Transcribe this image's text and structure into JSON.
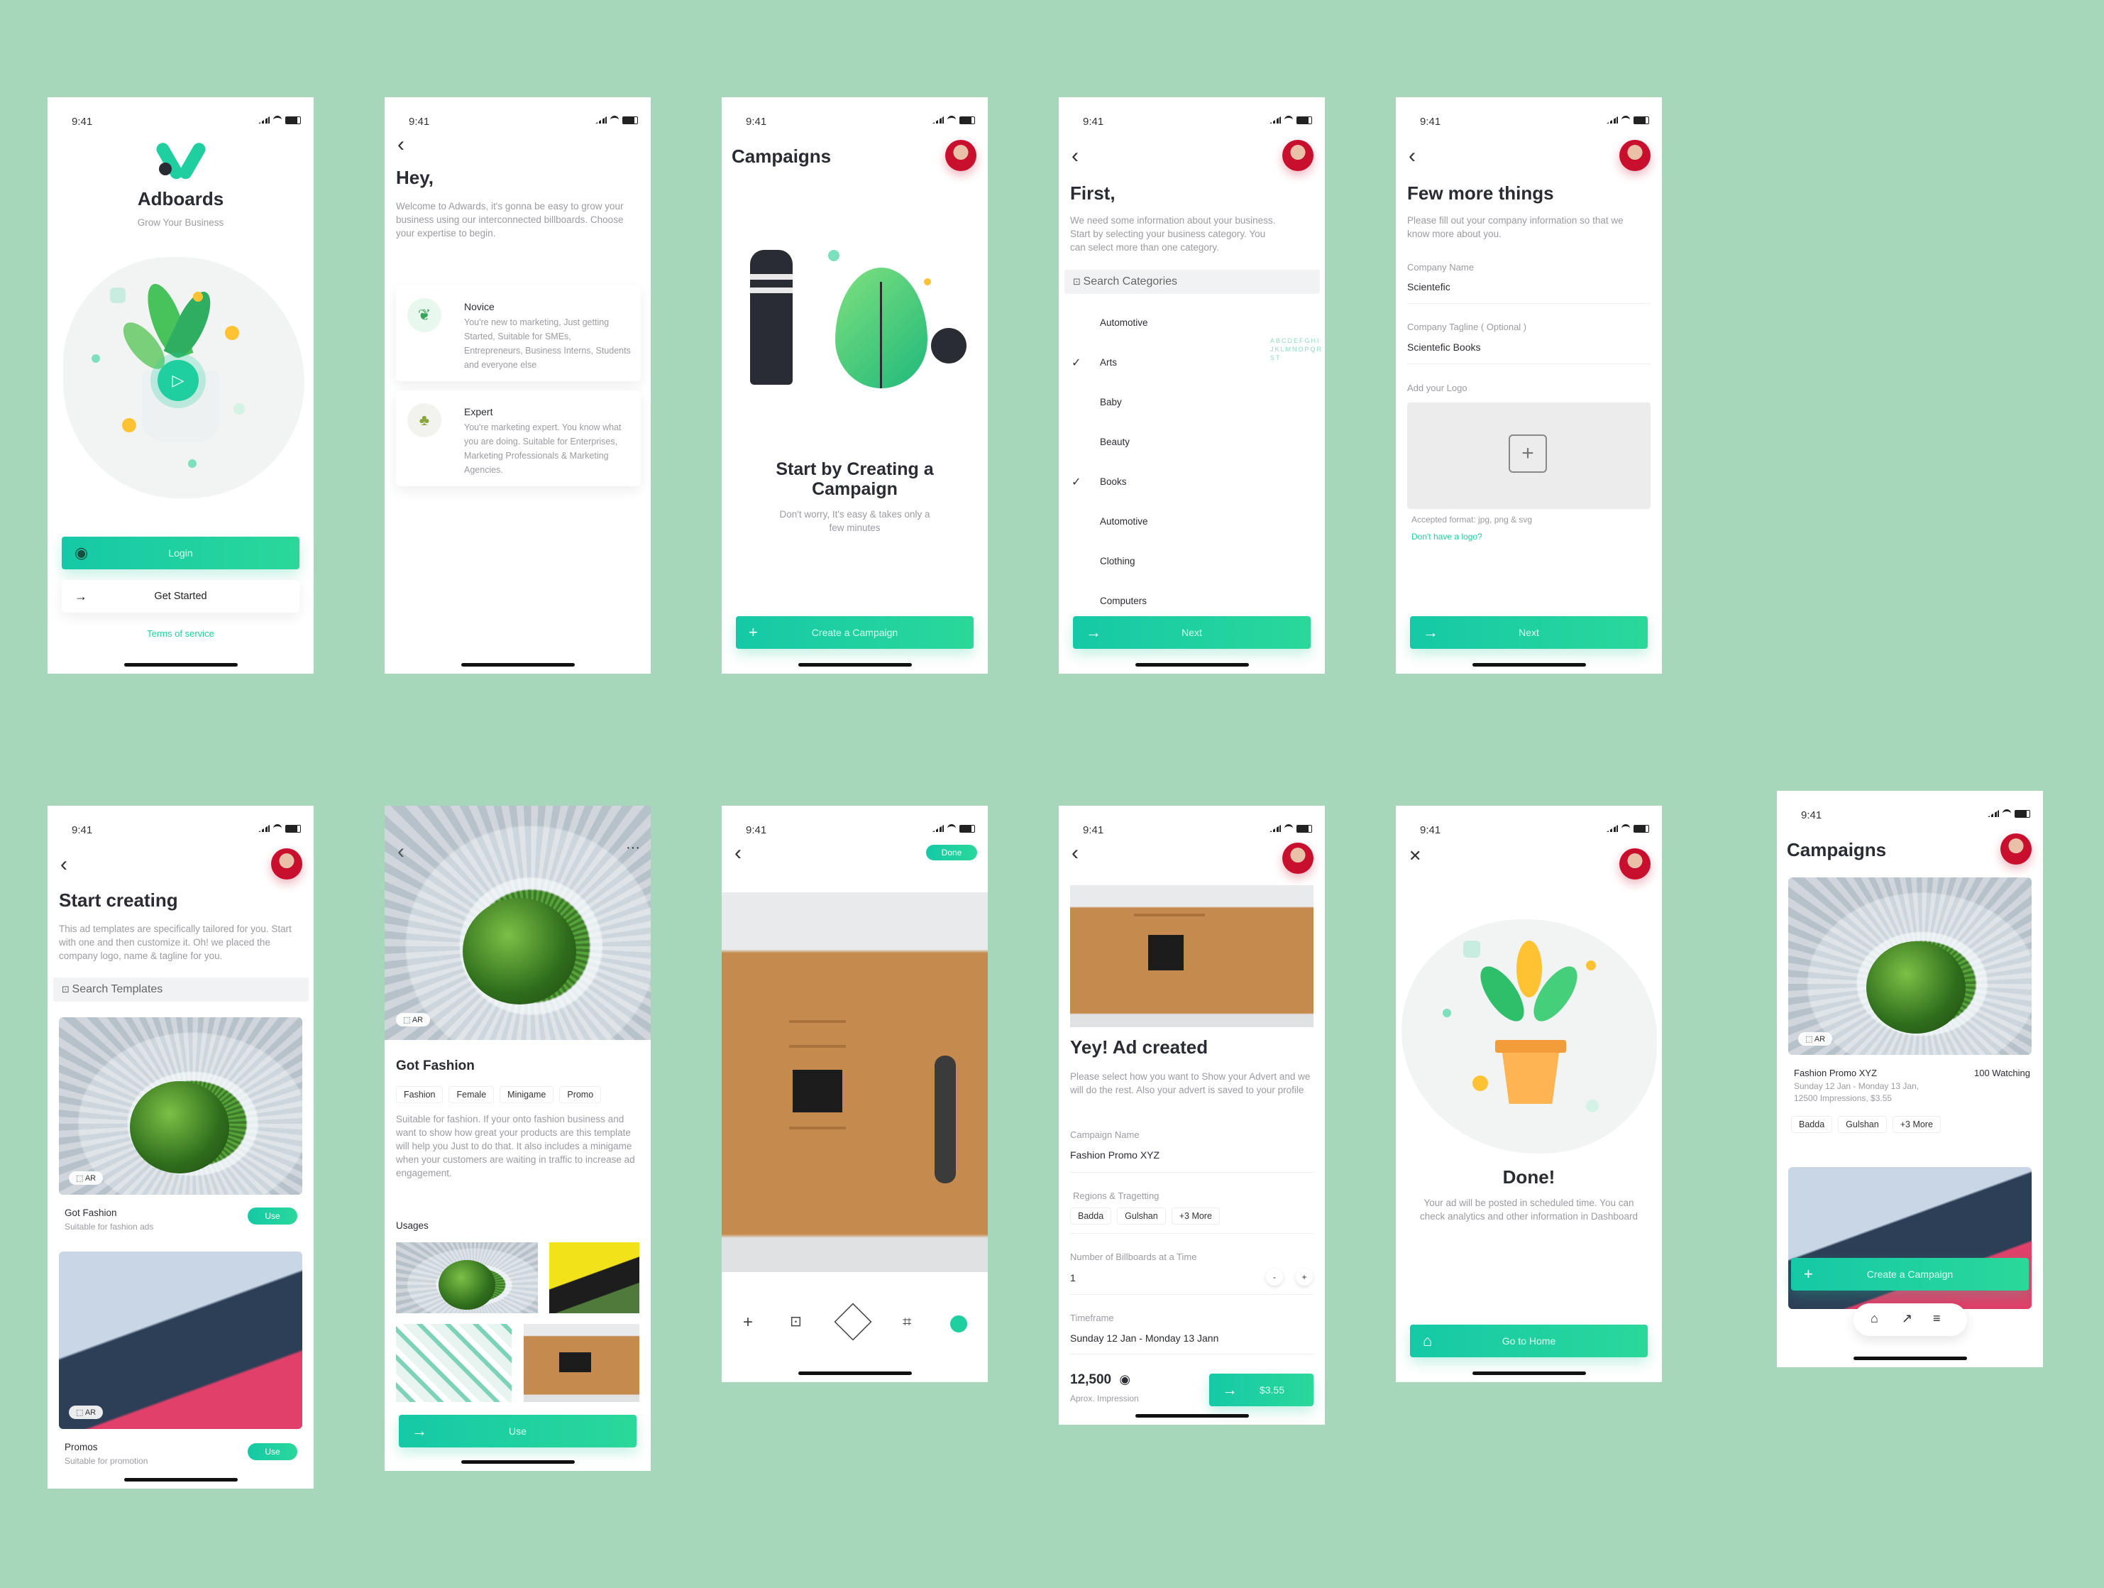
{
  "status_time": "9:41",
  "s1": {
    "brand": "Adboards",
    "tagline": "Grow Your Business",
    "login": "Login",
    "get_started": "Get Started",
    "terms": "Terms of service"
  },
  "s2": {
    "title": "Hey,",
    "intro": "Welcome to Adwards, it's gonna be easy to grow your business using our interconnected billboards. Choose your expertise to begin.",
    "options": [
      {
        "title": "Novice",
        "desc": "You're new to marketing, Just getting Started, Suitable for SMEs, Entrepreneurs, Business Interns, Students and everyone else"
      },
      {
        "title": "Expert",
        "desc": "You're marketing expert. You know what you are doing. Suitable for Enterprises, Marketing Professionals & Marketing Agencies."
      }
    ]
  },
  "s3": {
    "title": "Campaigns",
    "headline": "Start by Creating a Campaign",
    "sub": "Don't worry, It's easy & takes only a few minutes",
    "cta": "Create a Campaign"
  },
  "s4": {
    "title": "First,",
    "intro": "We need some information about your business. Start by selecting your business category. You can select more than one category.",
    "search": "Search Categories",
    "alphabet": "ABCDEFGHIJKLMNOPQRST",
    "categories": [
      {
        "name": "Automotive",
        "checked": false
      },
      {
        "name": "Arts",
        "checked": true
      },
      {
        "name": "Baby",
        "checked": false
      },
      {
        "name": "Beauty",
        "checked": false
      },
      {
        "name": "Books",
        "checked": true
      },
      {
        "name": "Automotive",
        "checked": false
      },
      {
        "name": "Clothing",
        "checked": false
      },
      {
        "name": "Computers",
        "checked": false
      }
    ],
    "next": "Next"
  },
  "s5": {
    "title": "Few more things",
    "intro": "Please fill out your company information so that we know more about you.",
    "company_label": "Company Name",
    "company_value": "Scientefic",
    "tagline_label": "Company Tagline ( Optional )",
    "tagline_value": "Scientefic Books",
    "logo_label": "Add your Logo",
    "accepted": "Accepted format: jpg, png & svg",
    "no_logo": "Don't have a logo?",
    "next": "Next"
  },
  "s6": {
    "title": "Start creating",
    "intro": "This ad templates are specifically tailored for you. Start with one and then customize it. Oh! we placed the company logo, name & tagline for you.",
    "search": "Search Templates",
    "ar": "AR",
    "use": "Use",
    "templates": [
      {
        "name": "Got Fashion",
        "desc": "Suitable for fashion ads"
      },
      {
        "name": "Promos",
        "desc": "Suitable for promotion"
      }
    ]
  },
  "s7": {
    "ar": "AR",
    "title": "Got Fashion",
    "tags": [
      "Fashion",
      "Female",
      "Minigame",
      "Promo"
    ],
    "desc": "Suitable for fashion. If your onto fashion business and want to show how great your products are this template will help you Just to do that. It also includes a minigame when your customers are waiting in traffic to increase ad engagement.",
    "usages": "Usages",
    "use": "Use"
  },
  "s8": {
    "done": "Done"
  },
  "s9": {
    "title": "Yey! Ad created",
    "intro": "Please select how you want to Show your Advert and we will do the rest. Also your advert is saved to your profile",
    "campaign_label": "Campaign Name",
    "campaign_value": "Fashion Promo XYZ",
    "regions_label": "Regions & Tragetting",
    "regions": [
      "Badda",
      "Gulshan",
      "+3 More"
    ],
    "billboards_label": "Number of Billboards at a Time",
    "billboards_value": "1",
    "minus": "-",
    "plus": "+",
    "timeframe_label": "Timeframe",
    "timeframe_value": "Sunday 12 Jan - Monday 13 Jann",
    "impressions": "12,500",
    "impressions_label": "Aprox. Impression",
    "price": "$3.55"
  },
  "s10": {
    "title": "Done!",
    "body": "Your ad will be posted in scheduled time. You can check analytics and other information in Dashboard",
    "cta": "Go to Home"
  },
  "s11": {
    "title": "Campaigns",
    "ar": "AR",
    "campaign_name": "Fashion Promo XYZ",
    "watching": "100 Watching",
    "details": "Sunday 12 Jan - Monday 13 Jan, 12500 Impressions, $3.55",
    "regions": [
      "Badda",
      "Gulshan",
      "+3 More"
    ],
    "cta": "Create a Campaign"
  },
  "colors": {
    "background": "#a7d7ba",
    "accent": "#1fcfa0",
    "text": "#2a2c33",
    "muted": "#9a9ba2"
  }
}
